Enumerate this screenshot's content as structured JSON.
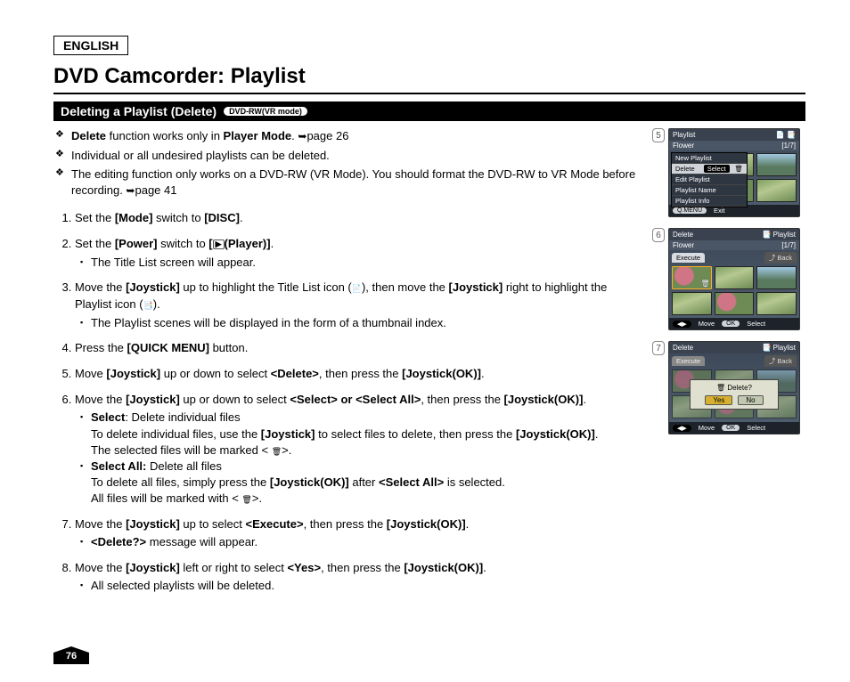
{
  "lang": "ENGLISH",
  "title": "DVD Camcorder: Playlist",
  "section": {
    "heading": "Deleting a Playlist (Delete)",
    "mode_badge": "DVD-RW(VR mode)"
  },
  "intro": [
    {
      "pre": "",
      "b1": "Delete",
      "mid1": " function works only in ",
      "b2": "Player Mode",
      "mid2": ". ",
      "arrow": "➥",
      "tail": "page 26"
    },
    {
      "text": "Individual or all undesired playlists can be deleted."
    },
    {
      "text_pre": "The editing function only works on a DVD-RW (VR Mode). You should format the DVD-RW to VR Mode before recording. ",
      "arrow": "➥",
      "tail": "page 41"
    }
  ],
  "steps": {
    "s1": {
      "pre": "Set the ",
      "b1": "[Mode]",
      "mid": " switch to ",
      "b2": "[DISC]",
      "post": "."
    },
    "s2": {
      "pre": "Set the ",
      "b1": "[Power]",
      "mid": " switch to ",
      "b2_pre": "[",
      "icon": "▶",
      "b2_post": "(Player)]",
      "post": ".",
      "sub1": "The Title List screen will appear."
    },
    "s3": {
      "pre": "Move the ",
      "b1": "[Joystick]",
      "mid1": " up to highlight the Title List icon (",
      "icon1": "📄",
      "mid2": "), then move the ",
      "b2": "[Joystick]",
      "mid3": " right to highlight the Playlist icon (",
      "icon2": "📑",
      "post": ").",
      "sub1": "The Playlist scenes will be displayed in the form of a thumbnail index."
    },
    "s4": {
      "pre": "Press the ",
      "b1": "[QUICK MENU]",
      "post": " button."
    },
    "s5": {
      "pre": "Move ",
      "b1": "[Joystick]",
      "mid1": " up or down to select ",
      "b2": "<Delete>",
      "mid2": ", then press the ",
      "b3": "[Joystick(OK)]",
      "post": "."
    },
    "s6": {
      "pre": "Move the ",
      "b1": "[Joystick]",
      "mid1": " up or down to select ",
      "b2": "<Select> or <Select All>",
      "mid2": ", then press the ",
      "b3": "[Joystick(OK)]",
      "post": ".",
      "sub_a_b": "Select",
      "sub_a_t1": ": Delete individual files",
      "sub_a_t2a": "To delete individual files, use the ",
      "sub_a_b2": "[Joystick]",
      "sub_a_t2b": " to select files to delete, then press the ",
      "sub_a_b3": "[Joystick(OK)]",
      "sub_a_t2c": ".",
      "sub_a_t3a": "The selected files will be marked < ",
      "sub_a_icon": "🗑",
      "sub_a_t3b": ">.",
      "sub_b_b": "Select All:",
      "sub_b_t1": " Delete all files",
      "sub_b_t2a": "To delete all files, simply press the ",
      "sub_b_b2": "[Joystick(OK)]",
      "sub_b_t2b": " after ",
      "sub_b_b3": "<Select All>",
      "sub_b_t2c": " is selected.",
      "sub_b_t3a": "All files will be marked with < ",
      "sub_b_icon": "🗑",
      "sub_b_t3b": ">."
    },
    "s7": {
      "pre": "Move the ",
      "b1": "[Joystick]",
      "mid1": " up to select ",
      "b2": "<Execute>",
      "mid2": ", then press the ",
      "b3": "[Joystick(OK)]",
      "post": ".",
      "sub1_b": "<Delete?>",
      "sub1_t": " message will appear."
    },
    "s8": {
      "pre": "Move the ",
      "b1": "[Joystick]",
      "mid1": " left or right to select ",
      "b2": "<Yes>",
      "mid2": ", then press the ",
      "b3": "[Joystick(OK)]",
      "post": ".",
      "sub1": "All selected playlists will be deleted."
    }
  },
  "page_number": "76",
  "figures": {
    "f5": {
      "num": "5",
      "header": "Playlist",
      "sub_left": "Flower",
      "sub_right": "[1/7]",
      "menu": {
        "i1": "New Playlist",
        "i2": "Delete",
        "i2_sel": "Select",
        "i3": "Edit Playlist",
        "i4": "Playlist Name",
        "i5": "Playlist Info"
      },
      "footer_pill": "Q.MENU",
      "footer_text": "Exit"
    },
    "f6": {
      "num": "6",
      "header_left": "Delete",
      "header_right": "Playlist",
      "sub_left": "Flower",
      "sub_right": "[1/7]",
      "tab_exec": "Execute",
      "tab_back": "Back",
      "foot_move": "Move",
      "foot_select": "Select",
      "foot_ok": "OK",
      "foot_arrows": "◀▶"
    },
    "f7": {
      "num": "7",
      "header_left": "Delete",
      "header_right": "Playlist",
      "tab_exec": "Execute",
      "tab_back": "Back",
      "dialog_icon": "🗑",
      "dialog_text": "Delete?",
      "dialog_yes": "Yes",
      "dialog_no": "No",
      "foot_move": "Move",
      "foot_select": "Select",
      "foot_ok": "OK",
      "foot_arrows": "◀▶"
    }
  }
}
